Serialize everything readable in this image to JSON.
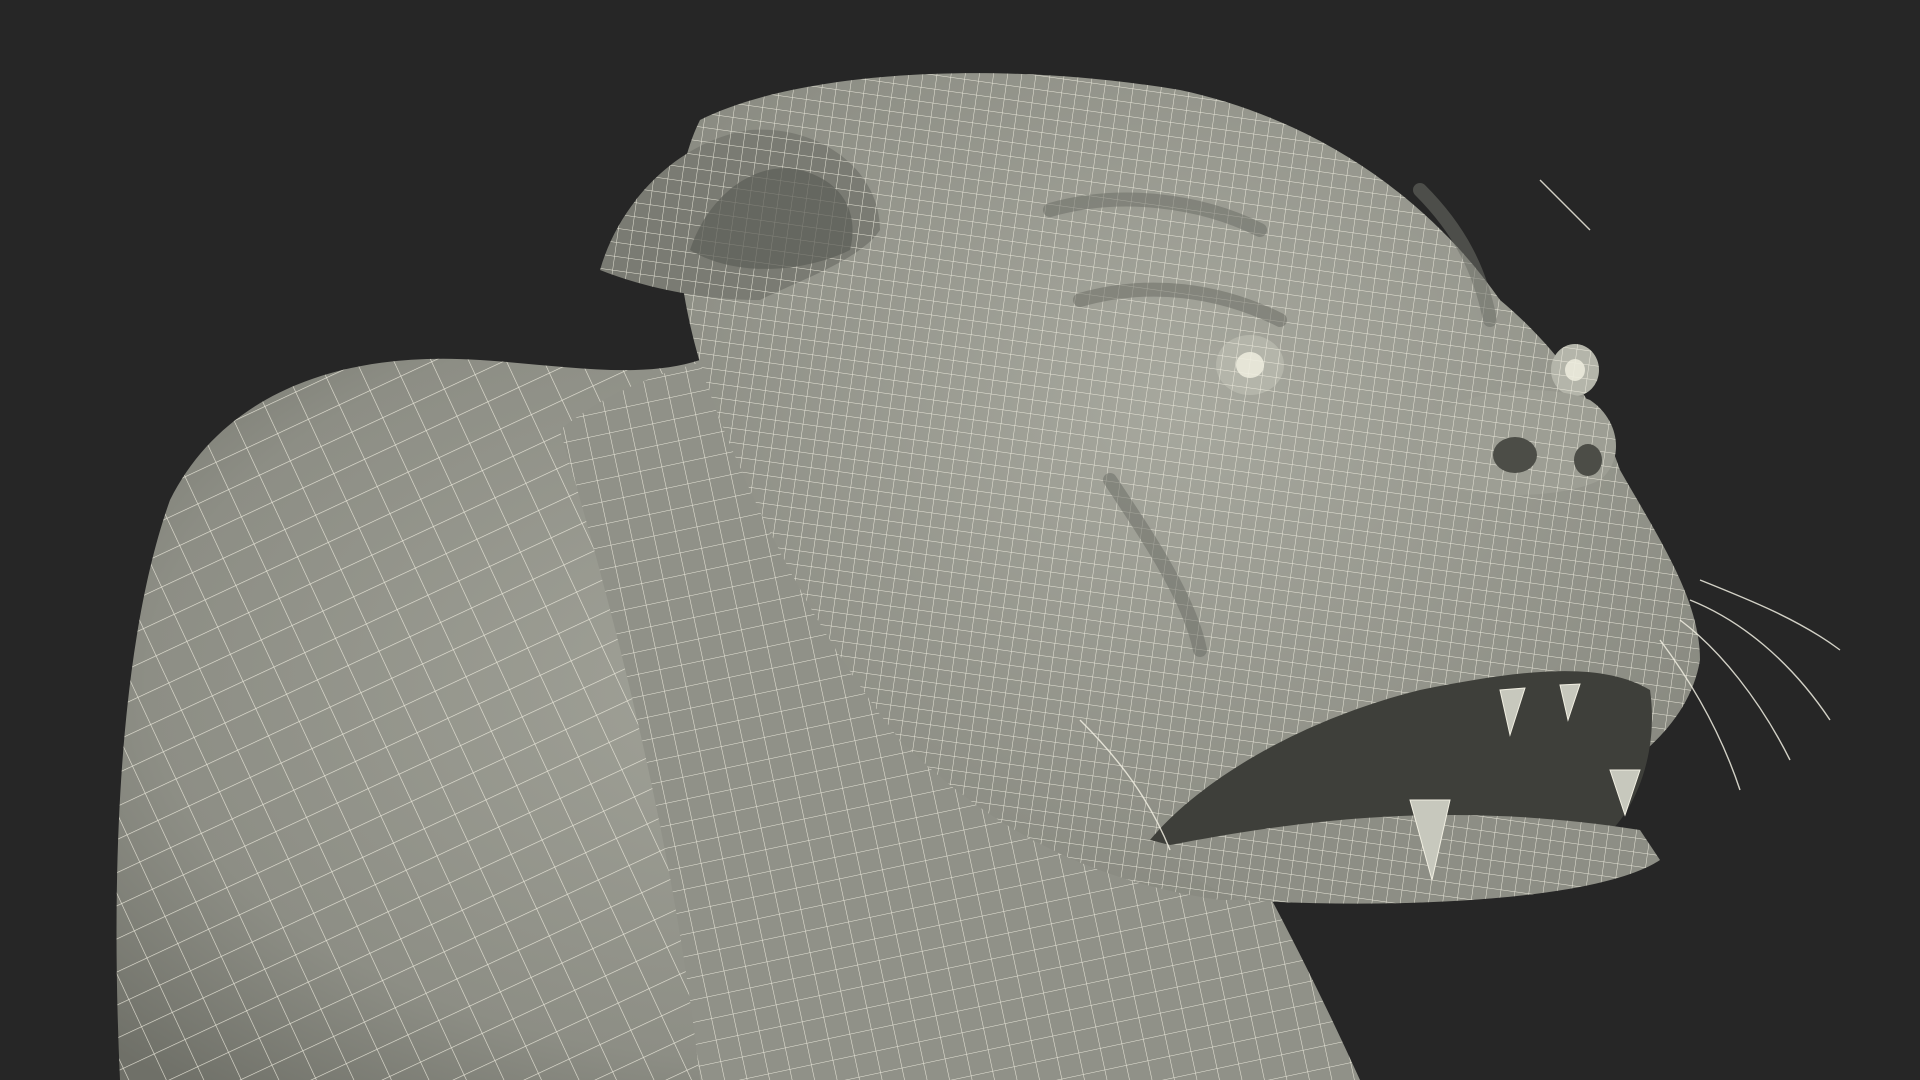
{
  "scene": {
    "subject": "bulldog-head-wireframe",
    "colors": {
      "background": "#262626",
      "surface": "#8f9087",
      "surface_light": "#a3a49a",
      "surface_shadow": "#6d6e66",
      "cavity": "#4a4b45",
      "wire": "#f1efe2"
    }
  }
}
